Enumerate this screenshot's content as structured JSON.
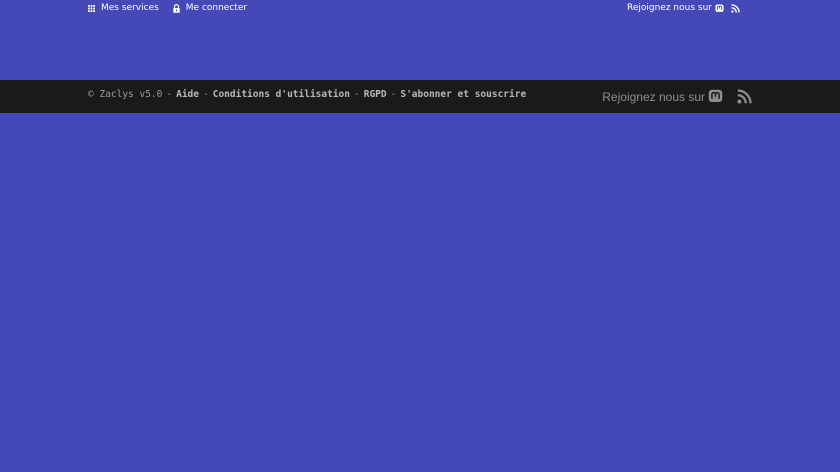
{
  "top_nav": {
    "services_label": "Mes services",
    "login_label": "Me connecter",
    "follow_label": "Rejoignez nous sur"
  },
  "footer": {
    "copyright": "© Zaclys v5.0",
    "links": [
      "Aide",
      "Conditions d'utilisation",
      "RGPD",
      "S'abonner et souscrire"
    ],
    "separator": "-",
    "follow_label": "Rejoignez nous sur"
  },
  "icons": {
    "services": "grid-icon",
    "login": "lock-icon",
    "social": "mastodon-icon",
    "feed": "rss-icon"
  },
  "colors": {
    "background": "#4549b8",
    "footer_bg": "#1a1a1a",
    "footer_text": "#9a9a9a"
  }
}
